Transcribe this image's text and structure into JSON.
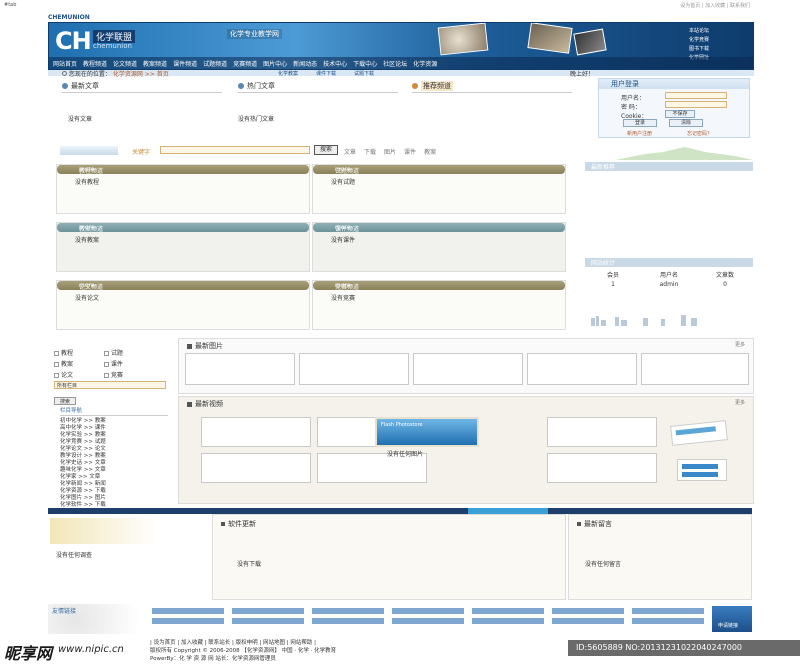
{
  "top": {
    "site_label": "#tab",
    "links": "设为首页 | 加入收藏 | 联系我们"
  },
  "header": {
    "logo_text": "CH",
    "logo_cn": "化学联盟",
    "logo_en": "chemunion",
    "logo_bar": "CHEMUNION",
    "slogan": "化学专业教学网",
    "quick_links": [
      "本站论坛",
      "化学竞赛",
      "图书下载",
      "化学网址"
    ],
    "nav": [
      "网站首页",
      "教程频道",
      "论文频道",
      "教案频道",
      "课件频道",
      "试题频道",
      "竞赛频道",
      "图片中心",
      "新闻动态",
      "技术中心",
      "下载中心",
      "社区论坛",
      "化学资源"
    ],
    "subnav": [
      "化学教案",
      "课件下载",
      "试题下载"
    ]
  },
  "location": {
    "prefix": "您现在的位置：",
    "path": "化学资源网 >> 首页",
    "greeting": "晚上好！"
  },
  "columns": {
    "latest_title": "最新文章",
    "latest_empty": "没有文章",
    "hot_title": "热门文章",
    "hot_empty": "没有热门文章",
    "recommend_title": "推荐频道"
  },
  "login": {
    "title": "用户登录",
    "user_label": "用户名：",
    "pass_label": "密 码：",
    "cookie_label": "Cookie：",
    "cookie_value": "不保存",
    "login_btn": "登录",
    "clear_btn": "清除",
    "register": "新用户注册",
    "forgot": "忘记密码？"
  },
  "search": {
    "label": "关键字",
    "button": "搜索",
    "options": [
      "文章",
      "下载",
      "图片",
      "课件",
      "教案"
    ]
  },
  "panels": [
    {
      "title": "教程频道",
      "empty": "没有教程",
      "style": "olive"
    },
    {
      "title": "试题频道",
      "empty": "没有试题",
      "style": "olive"
    },
    {
      "title": "教案频道",
      "empty": "没有教案",
      "style": "teal"
    },
    {
      "title": "课件频道",
      "empty": "没有课件",
      "style": "teal"
    },
    {
      "title": "论文频道",
      "empty": "没有论文",
      "style": "olive"
    },
    {
      "title": "竞赛频道",
      "empty": "没有竞赛",
      "style": "olive"
    }
  ],
  "right": {
    "recommend_title": "最新推荐",
    "stats_title": "网站统计",
    "stats_headers": [
      "会员",
      "用户名",
      "文章数"
    ],
    "stats_values": [
      "1",
      "admin",
      "0"
    ]
  },
  "lower_left": {
    "checks": [
      "教程",
      "试题",
      "教案",
      "课件",
      "论文",
      "竞赛"
    ],
    "cat_title": "栏目导航",
    "cats": [
      "初中化学 >> 教案",
      "高中化学 >> 课件",
      "化学实验 >> 教案",
      "化学竞赛 >> 试题",
      "化学论文 >> 论文",
      "教学设计 >> 教案",
      "化学史话 >> 文章",
      "趣味化学 >> 文章",
      "化学家 >> 文章",
      "化学新闻 >> 新闻",
      "化学资源 >> 下载",
      "化学图片 >> 图片",
      "化学软件 >> 下载",
      "化学网址 >> 链接"
    ],
    "select_label": "所有栏目",
    "go_btn": "搜索"
  },
  "images": {
    "title": "最新图片",
    "more": "更多",
    "video_title": "最新视频",
    "video_empty": "没有任何图片",
    "video_card": "Flash Photostore"
  },
  "bottom": {
    "left_title": "网站调查",
    "left_empty": "没有任何调查",
    "mid_title": "软件更新",
    "mid_empty": "没有下载",
    "right_title": "最新留言",
    "right_empty": "没有任何留言"
  },
  "friend": {
    "title": "友情链接",
    "more": "申请链接"
  },
  "footer": {
    "line1": "| 设为首页 | 加入收藏 | 联系站长 | 版权申明 | 网站地图 | 网站帮助 |",
    "line2": "版权所有 Copyright © 2006-2008 【化学资源网】 中国 · 化学 · 化学教育",
    "line3": "PowerBy：化 学 资 源 网  站长：化学资源网管理员"
  },
  "watermark": {
    "left": "昵享网",
    "url": "www.nipic.cn",
    "right": "ID:5605889 NO:20131231022040247000"
  }
}
